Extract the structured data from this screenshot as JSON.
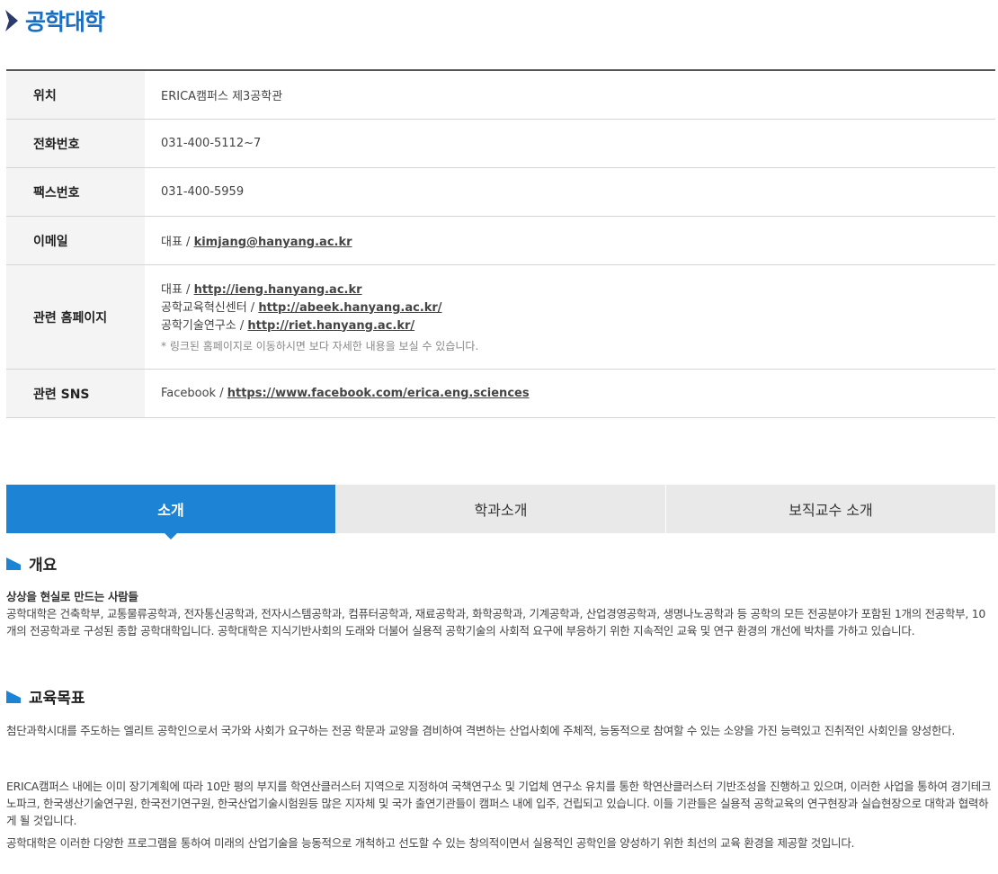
{
  "page": {
    "title": "공학대학"
  },
  "info": {
    "location": {
      "label": "위치",
      "value": "ERICA캠퍼스 제3공학관"
    },
    "phone": {
      "label": "전화번호",
      "value": "031-400-5112~7"
    },
    "fax": {
      "label": "팩스번호",
      "value": "031-400-5959"
    },
    "email": {
      "label": "이메일",
      "prefix": "대표 / ",
      "link": "kimjang@hanyang.ac.kr"
    },
    "homepage": {
      "label": "관련 홈페이지",
      "items": [
        {
          "prefix": "대표 / ",
          "link": "http://ieng.hanyang.ac.kr"
        },
        {
          "prefix": "공학교육혁신센터 / ",
          "link": "http://abeek.hanyang.ac.kr/"
        },
        {
          "prefix": "공학기술연구소 / ",
          "link": "http://riet.hanyang.ac.kr/"
        }
      ],
      "note": "* 링크된 홈페이지로 이동하시면 보다 자세한 내용을 보실 수 있습니다."
    },
    "sns": {
      "label": "관련 SNS",
      "prefix": "Facebook / ",
      "link": "https://www.facebook.com/erica.eng.sciences"
    }
  },
  "tabs": [
    {
      "label": "소개",
      "active": true
    },
    {
      "label": "학과소개",
      "active": false
    },
    {
      "label": "보직교수 소개",
      "active": false
    }
  ],
  "overview": {
    "heading": "개요",
    "subtitle": "상상을 현실로 만드는 사람들",
    "text": "공학대학은 건축학부, 교통물류공학과, 전자통신공학과, 전자시스템공학과, 컴퓨터공학과, 재료공학과, 화학공학과, 기계공학과, 산업경영공학과, 생명나노공학과 등 공학의 모든 전공분야가 포함된 1개의 전공학부, 10개의 전공학과로 구성된 종합 공학대학입니다. 공학대학은 지식기반사회의 도래와 더불어 실용적 공학기술의 사회적 요구에 부응하기 위한 지속적인 교육 및 연구 환경의 개선에 박차를 가하고 있습니다."
  },
  "goals": {
    "heading": "교육목표",
    "paragraph1": "첨단과학시대를 주도하는 엘리트 공학인으로서 국가와 사회가 요구하는 전공 학문과 교양을 겸비하여 격변하는 산업사회에 주체적, 능동적으로 참여할 수 있는 소양을 가진 능력있고 진취적인 사회인을 양성한다.",
    "paragraph2": "ERICA캠퍼스 내에는 이미 장기계획에 따라 10만 평의 부지를 학연산클러스터 지역으로 지정하여 국책연구소 및 기업체 연구소 유치를 통한 학연산클러스터 기반조성을 진행하고 있으며, 이러한 사업을 통하여 경기테크노파크, 한국생산기술연구원, 한국전기연구원, 한국산업기술시험원등 많은 지자체 및 국가 출연기관들이 캠퍼스 내에 입주, 건립되고 있습니다. 이들 기관들은 실용적 공학교육의 연구현장과 실습현장으로 대학과 협력하게 될 것입니다.",
    "paragraph3": "공학대학은 이러한 다양한 프로그램을 통하여 미래의 산업기술을 능동적으로 개척하고 선도할 수 있는 창의적이면서 실용적인 공학인을 양성하기 위한 최선의 교육 환경을 제공할 것입니다."
  },
  "colors": {
    "accent": "#1d83d5",
    "title": "#1a6fc3",
    "tab_inactive": "#e9e9e9",
    "table_header": "#f4f4f4"
  }
}
